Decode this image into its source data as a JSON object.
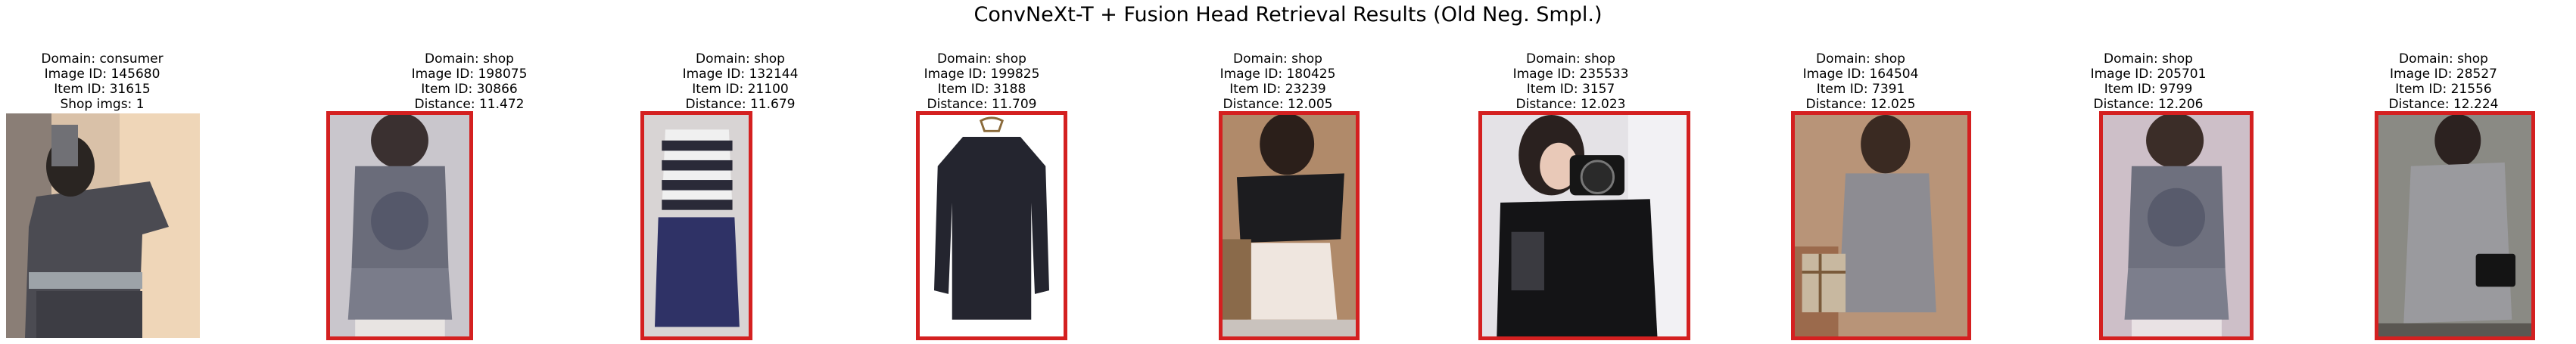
{
  "title": "ConvNeXt-T + Fusion Head Retrieval Results (Old Neg. Smpl.)",
  "query": {
    "domain": "Domain: consumer",
    "image_id": "Image ID: 145680",
    "item_id": "Item ID: 31615",
    "extra": "Shop imgs: 1"
  },
  "results": [
    {
      "domain": "Domain: shop",
      "image_id": "Image ID: 198075",
      "item_id": "Item ID: 30866",
      "distance": "Distance: 11.472"
    },
    {
      "domain": "Domain: shop",
      "image_id": "Image ID: 132144",
      "item_id": "Item ID: 21100",
      "distance": "Distance: 11.679"
    },
    {
      "domain": "Domain: shop",
      "image_id": "Image ID: 199825",
      "item_id": "Item ID: 3188",
      "distance": "Distance: 11.709"
    },
    {
      "domain": "Domain: shop",
      "image_id": "Image ID: 180425",
      "item_id": "Item ID: 23239",
      "distance": "Distance: 12.005"
    },
    {
      "domain": "Domain: shop",
      "image_id": "Image ID: 235533",
      "item_id": "Item ID: 3157",
      "distance": "Distance: 12.023"
    },
    {
      "domain": "Domain: shop",
      "image_id": "Image ID: 164504",
      "item_id": "Item ID: 7391",
      "distance": "Distance: 12.025"
    },
    {
      "domain": "Domain: shop",
      "image_id": "Image ID: 205701",
      "item_id": "Item ID: 9799",
      "distance": "Distance: 12.206"
    },
    {
      "domain": "Domain: shop",
      "image_id": "Image ID: 28527",
      "item_id": "Item ID: 21556",
      "distance": "Distance: 12.224"
    }
  ],
  "colors": {
    "mismatch_border": "#d42020"
  }
}
